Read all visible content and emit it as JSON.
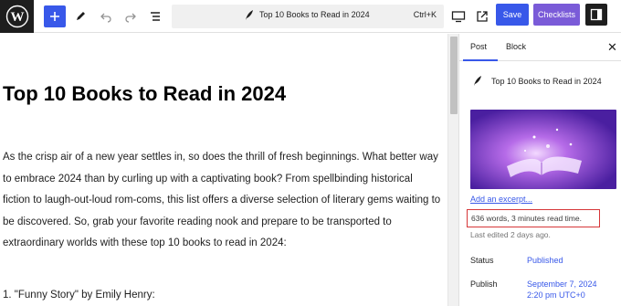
{
  "toolbar": {
    "document_title": "Top 10 Books to Read in 2024",
    "shortcut": "Ctrl+K",
    "save_label": "Save",
    "checklists_label": "Checklists"
  },
  "post": {
    "title": "Top 10 Books to Read in 2024",
    "paragraph": "As the crisp air of a new year settles in, so does the thrill of fresh beginnings. What better way to embrace 2024 than by curling up with a captivating book? From spellbinding historical fiction to laugh-out-loud rom-coms, this list offers a diverse selection of literary gems waiting to be discovered. So, grab your favorite reading nook and prepare to be transported to extraordinary worlds with these top 10 books to read in 2024:",
    "list_items": [
      "\"Funny Story\" by Emily Henry:"
    ]
  },
  "sidebar": {
    "tabs": {
      "post": "Post",
      "block": "Block"
    },
    "summary_title": "Top 10 Books to Read in 2024",
    "excerpt_link": "Add an excerpt...",
    "read_time": "636 words, 3 minutes read time.",
    "last_edited": "Last edited 2 days ago.",
    "status_label": "Status",
    "status_value": "Published",
    "publish_label": "Publish",
    "publish_date": "September 7, 2024",
    "publish_time": "2:20 pm UTC+0"
  },
  "colors": {
    "accent": "#3858e9",
    "checklists": "#7a5bd8",
    "highlight_border": "#d63638"
  }
}
